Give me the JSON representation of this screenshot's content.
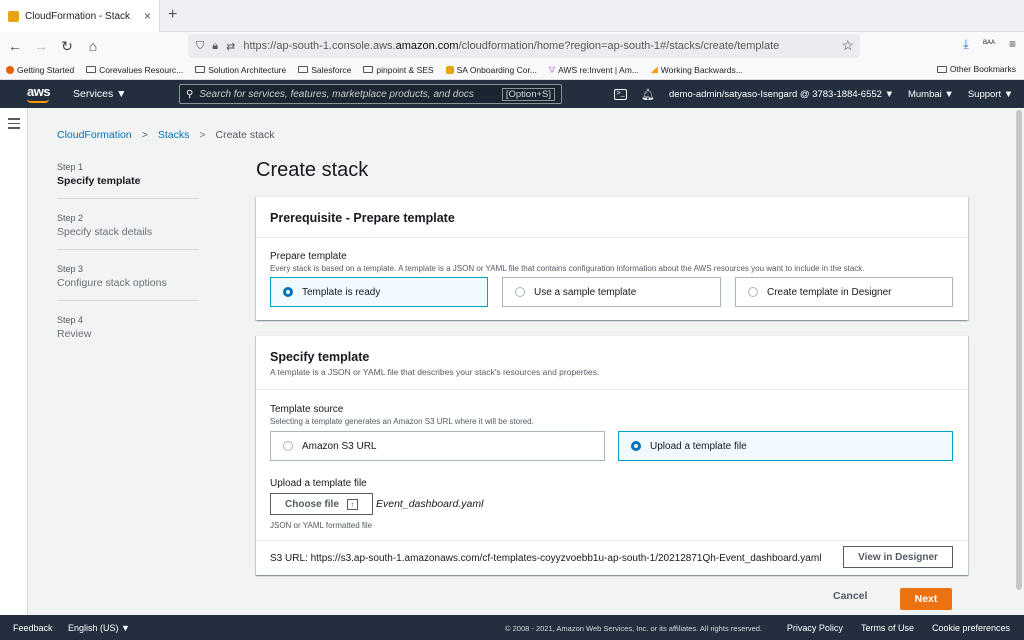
{
  "browser": {
    "tab_title": "CloudFormation - Stack",
    "tab_close": "×",
    "new_tab": "+",
    "url_prefix": "https://ap-south-1.console.aws.",
    "url_domain": "amazon.com",
    "url_suffix": "/cloudformation/home?region=ap-south-1#/stacks/create/template",
    "ext_label": "aᴀᴀ",
    "bookmarks": [
      {
        "label": "Getting Started",
        "icon": "firefox-icon"
      },
      {
        "label": "Corevalues Resourc...",
        "icon": "folder-icon"
      },
      {
        "label": "Solution Architecture",
        "icon": "folder-icon"
      },
      {
        "label": "Salesforce",
        "icon": "folder-icon"
      },
      {
        "label": "pinpoint & SES",
        "icon": "folder-icon"
      },
      {
        "label": "SA Onboarding Cor...",
        "icon": "aws-box-icon"
      },
      {
        "label": "AWS re:Invent | Am...",
        "icon": "reinvent-icon"
      },
      {
        "label": "Working Backwards...",
        "icon": "amazon-icon"
      }
    ],
    "other_bookmarks": "Other Bookmarks"
  },
  "aws_header": {
    "logo": "aws",
    "services": "Services ▼",
    "search_placeholder": "Search for services, features, marketplace products, and docs",
    "search_shortcut": "[Option+S]",
    "account": "demo-admin/satyaso-Isengard @ 3783-1884-6552 ▼",
    "region": "Mumbai ▼",
    "support": "Support ▼"
  },
  "breadcrumb": {
    "item1": "CloudFormation",
    "item2": "Stacks",
    "current": "Create stack",
    "sep": ">"
  },
  "steps": [
    {
      "num": "Step 1",
      "label": "Specify template"
    },
    {
      "num": "Step 2",
      "label": "Specify stack details"
    },
    {
      "num": "Step 3",
      "label": "Configure stack options"
    },
    {
      "num": "Step 4",
      "label": "Review"
    }
  ],
  "page_title": "Create stack",
  "prereq": {
    "heading": "Prerequisite - Prepare template",
    "field_label": "Prepare template",
    "field_desc": "Every stack is based on a template. A template is a JSON or YAML file that contains configuration information about the AWS resources you want to include in the stack.",
    "options": [
      "Template is ready",
      "Use a sample template",
      "Create template in Designer"
    ],
    "selected": "Template is ready"
  },
  "specify": {
    "heading": "Specify template",
    "desc": "A template is a JSON or YAML file that describes your stack's resources and properties.",
    "source_label": "Template source",
    "source_desc": "Selecting a template generates an Amazon S3 URL where it will be stored.",
    "source_options": [
      "Amazon S3 URL",
      "Upload a template file"
    ],
    "source_selected": "Upload a template file",
    "upload_label": "Upload a template file",
    "choose_file": "Choose file",
    "file_name": "Event_dashboard.yaml",
    "upload_hint": "JSON or YAML formatted file",
    "s3_url_label": "S3 URL:",
    "s3_url": "https://s3.ap-south-1.amazonaws.com/cf-templates-coyyzvoebb1u-ap-south-1/20212871Qh-Event_dashboard.yaml",
    "view_designer": "View in Designer"
  },
  "actions": {
    "cancel": "Cancel",
    "next": "Next"
  },
  "footer": {
    "feedback": "Feedback",
    "language": "English (US) ▼",
    "copyright": "© 2008 - 2021, Amazon Web Services, Inc. or its affiliates. All rights reserved.",
    "privacy": "Privacy Policy",
    "terms": "Terms of Use",
    "cookies": "Cookie preferences"
  },
  "colors": {
    "aws_nav": "#232f3e",
    "link": "#0073bb",
    "primary_button": "#ec7211",
    "selected_tile_border": "#00a1c9"
  }
}
